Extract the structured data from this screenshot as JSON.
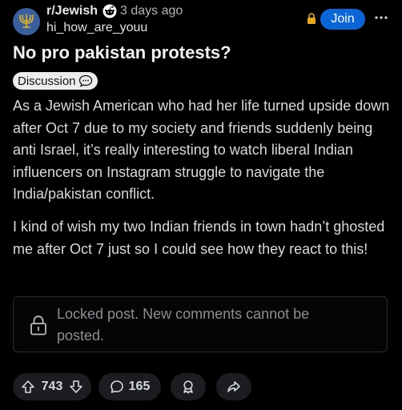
{
  "header": {
    "subreddit": "r/Jewish",
    "age": "3 days ago",
    "username": "hi_how_are_youu",
    "join_label": "Join",
    "avatar_icon": "menorah-icon",
    "more_icon": "more-options-icon"
  },
  "post": {
    "title": "No pro pakistan protests?",
    "flair": "Discussion",
    "flair_icon": "speech-bubble-icon",
    "paragraphs": [
      "As a Jewish American who had her life turned upside down after Oct 7 due to my society and friends suddenly being anti Israel, it’s really interesting to watch liberal Indian influencers on Instagram struggle to navigate the India/pakistan conflict.",
      "I kind of wish my two Indian friends in town hadn’t ghosted me after Oct 7 just so I could see how they react to this!"
    ]
  },
  "locked_notice": "Locked post. New comments cannot be posted.",
  "actions": {
    "votes": "743",
    "comments": "165"
  },
  "colors": {
    "background": "#000000",
    "join_button": "#0a66d8",
    "lock_accent": "#e6a817",
    "flair_bg": "#ececec"
  }
}
